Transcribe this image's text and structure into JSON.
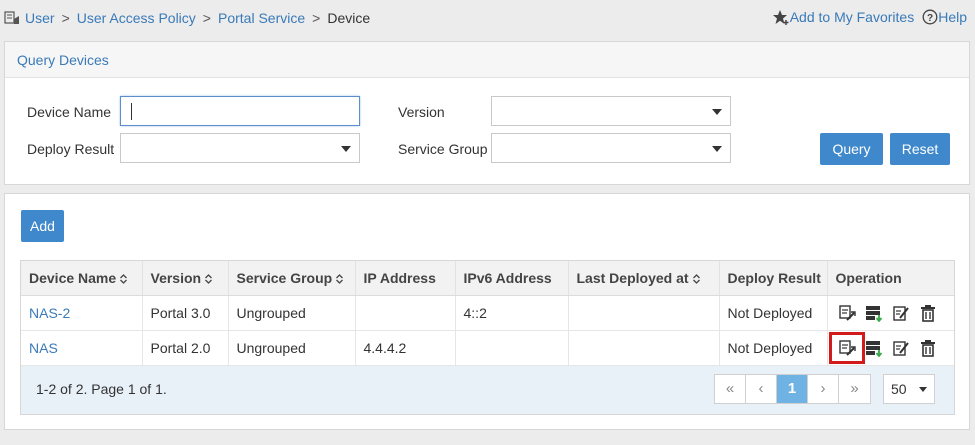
{
  "breadcrumb": {
    "items": [
      "User",
      "User Access Policy",
      "Portal Service"
    ],
    "separator": ">",
    "current": "Device"
  },
  "topright": {
    "favorites": "Add to My Favorites",
    "help": "Help"
  },
  "query": {
    "title": "Query Devices",
    "device_name_label": "Device Name",
    "device_name_value": "",
    "version_label": "Version",
    "version_value": "",
    "deploy_result_label": "Deploy Result",
    "deploy_result_value": "",
    "service_group_label": "Service Group",
    "service_group_value": "",
    "query_button": "Query",
    "reset_button": "Reset"
  },
  "toolbar": {
    "add_button": "Add"
  },
  "table": {
    "columns": [
      "Device Name",
      "Version",
      "Service Group",
      "IP Address",
      "IPv6 Address",
      "Last Deployed at",
      "Deploy Result",
      "Operation"
    ],
    "rows": [
      [
        "NAS-2",
        "Portal 3.0",
        "Ungrouped",
        "",
        "4::2",
        "",
        "Not Deployed"
      ],
      [
        "NAS",
        "Portal 2.0",
        "Ungrouped",
        "4.4.4.2",
        "",
        "",
        "Not Deployed"
      ]
    ],
    "operation_icons": [
      "deploy-icon",
      "export-icon",
      "edit-icon",
      "delete-icon"
    ],
    "highlighted_operation": {
      "row": 1,
      "icon": "deploy-icon",
      "color": "#d21c1c"
    }
  },
  "pagination": {
    "info": "1-2 of 2. Page 1 of 1.",
    "first": "«",
    "prev": "‹",
    "current_page": "1",
    "next": "›",
    "last": "»",
    "page_size": "50"
  },
  "colors": {
    "accent": "#3f88cc",
    "link": "#3a7ab8",
    "active_page": "#6fb3e4",
    "footer": "#e8f0f8"
  }
}
